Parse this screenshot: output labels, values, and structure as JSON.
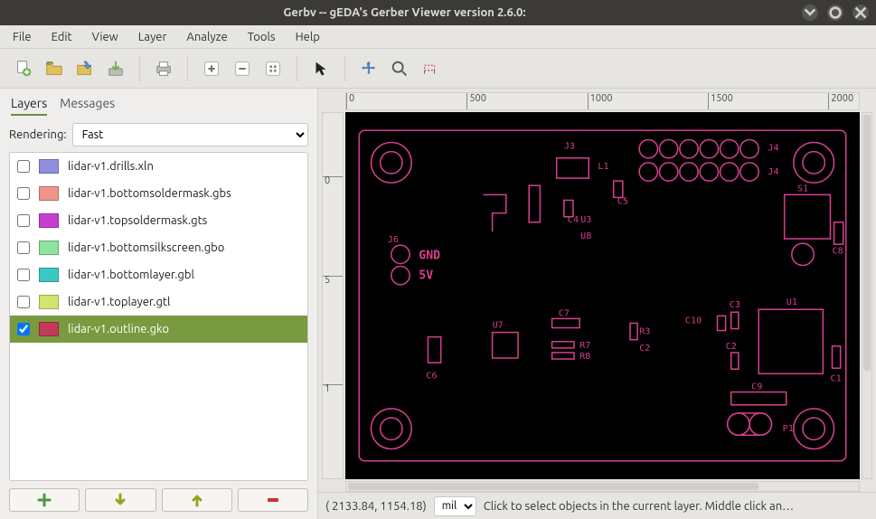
{
  "titlebar": {
    "title": "Gerbv -- gEDA's Gerber Viewer version 2.6.0:"
  },
  "menu": {
    "file": "File",
    "edit": "Edit",
    "view": "View",
    "layer": "Layer",
    "analyze": "Analyze",
    "tools": "Tools",
    "help": "Help"
  },
  "sidebar": {
    "tabs": {
      "layers": "Layers",
      "messages": "Messages"
    },
    "rendering_label": "Rendering:",
    "rendering_value": "Fast",
    "layers": [
      {
        "checked": false,
        "color": "#908fdc",
        "name": "lidar-v1.drills.xln",
        "selected": false
      },
      {
        "checked": false,
        "color": "#f0948a",
        "name": "lidar-v1.bottomsoldermask.gbs",
        "selected": false
      },
      {
        "checked": false,
        "color": "#c43fd0",
        "name": "lidar-v1.topsoldermask.gts",
        "selected": false
      },
      {
        "checked": false,
        "color": "#8de49c",
        "name": "lidar-v1.bottomsilkscreen.gbo",
        "selected": false
      },
      {
        "checked": false,
        "color": "#3cc8c2",
        "name": "lidar-v1.bottomlayer.gbl",
        "selected": false
      },
      {
        "checked": false,
        "color": "#d4e36e",
        "name": "lidar-v1.toplayer.gtl",
        "selected": false
      },
      {
        "checked": true,
        "color": "#c33a5b",
        "name": "lidar-v1.outline.gko",
        "selected": true
      }
    ]
  },
  "ruler": {
    "h": [
      "0",
      "500",
      "1000",
      "1500",
      "2000"
    ],
    "v": [
      "0",
      "5",
      "1"
    ]
  },
  "pcb": {
    "labels": [
      "J3",
      "L1",
      "J4",
      "J4",
      "S1",
      "C5",
      "C8",
      "U3",
      "C4",
      "U8",
      "GND",
      "5V",
      "J6",
      "U7",
      "C7",
      "C10",
      "C3",
      "U1",
      "C2",
      "C6",
      "R3",
      "R7",
      "R8",
      "C2",
      "C1",
      "C9",
      "P1"
    ]
  },
  "status": {
    "coords": "( 2133.84,  1154.18)",
    "units": "mil",
    "hint": "Click to select objects in the current layer. Middle click an…"
  }
}
